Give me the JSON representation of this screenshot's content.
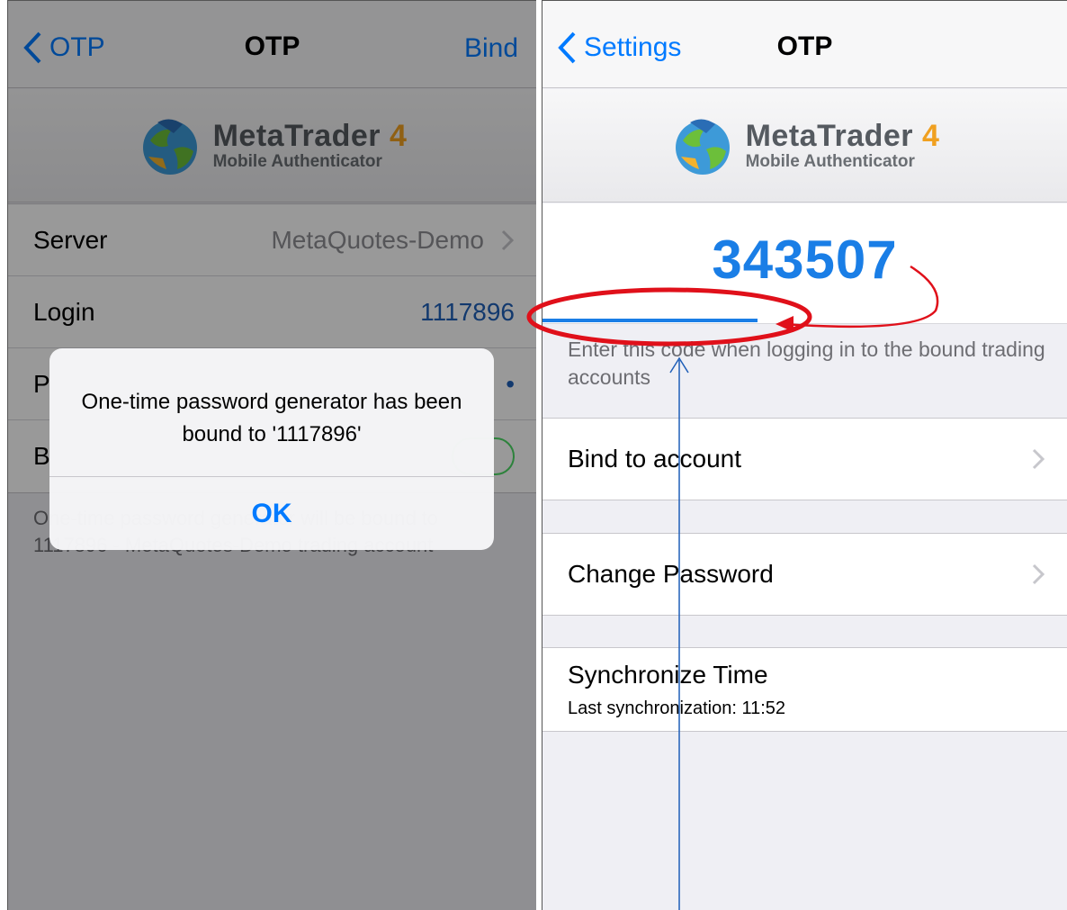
{
  "left": {
    "nav": {
      "back_label": "OTP",
      "title": "OTP",
      "right_label": "Bind"
    },
    "logo": {
      "title": "MetaTrader",
      "title_number": "4",
      "subtitle": "Mobile Authenticator"
    },
    "rows": [
      {
        "label": "Server",
        "value": "MetaQuotes-Demo"
      },
      {
        "label": "Login",
        "value": "1117896"
      },
      {
        "label": "P",
        "value": "•"
      },
      {
        "label": "B",
        "value": ""
      }
    ],
    "footer": "One-time password generator will be bound to 1117896 - MetaQuotes-Demo trading account",
    "alert": {
      "message": "One-time password generator has been bound to '1117896'",
      "ok_label": "OK"
    }
  },
  "right": {
    "nav": {
      "back_label": "Settings",
      "title": "OTP"
    },
    "logo": {
      "title": "MetaTrader",
      "title_number": "4",
      "subtitle": "Mobile Authenticator"
    },
    "otp": {
      "code": "343507",
      "progress_fraction": 0.41,
      "hint": "Enter this code when logging in to the bound trading accounts"
    },
    "items": {
      "bind": "Bind to account",
      "change_password": "Change Password",
      "sync_title": "Synchronize Time",
      "sync_subtitle": "Last synchronization: 11:52"
    }
  },
  "colors": {
    "ios_blue": "#007aff",
    "otp_blue": "#1a7ee6",
    "annotation_red": "#e0101a",
    "annotation_blue": "#1f5fb8"
  }
}
